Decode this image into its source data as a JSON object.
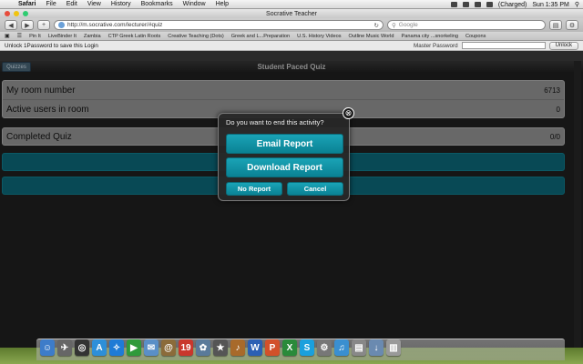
{
  "menubar": {
    "items": [
      "Safari",
      "File",
      "Edit",
      "View",
      "History",
      "Bookmarks",
      "Window",
      "Help"
    ],
    "battery": "(Charged)",
    "clock": "Sun 1:35 PM"
  },
  "window": {
    "title": "Socrative Teacher",
    "url": "http://m.socrative.com/lecturer/#quiz",
    "search_placeholder": "Google"
  },
  "bookmarks": [
    "Pin It",
    "LiveBinder It",
    "Zambia",
    "CTP Greek Latin Roots",
    "Creative Teaching (Dots)",
    "Greek and L...Preparation",
    "U.S. History Videos",
    "Outline Music World",
    "Panama city ...snorkeling",
    "Coupons"
  ],
  "password_bar": {
    "message": "Unlock 1Password to save this Login",
    "label": "Master Password",
    "unlock": "Unlock"
  },
  "page": {
    "quizzes_button": "Quizzes",
    "title": "Student Paced Quiz",
    "room_label": "My room number",
    "room_value": "6713",
    "active_label": "Active users in room",
    "active_value": "0",
    "completed_label": "Completed Quiz",
    "completed_value": "0/0"
  },
  "modal": {
    "title": "Do you want to end this activity?",
    "close_glyph": "⊗",
    "email": "Email Report",
    "download": "Download Report",
    "no_report": "No Report",
    "cancel": "Cancel"
  },
  "dock": {
    "icons": [
      {
        "name": "finder-icon",
        "glyph": "☺",
        "color": "#3d7cc9"
      },
      {
        "name": "launchpad-icon",
        "glyph": "✈",
        "color": "#666"
      },
      {
        "name": "dashboard-icon",
        "glyph": "◎",
        "color": "#333"
      },
      {
        "name": "app-store-icon",
        "glyph": "A",
        "color": "#2d8fd9"
      },
      {
        "name": "safari-icon",
        "glyph": "✧",
        "color": "#1f7bd6"
      },
      {
        "name": "facetime-icon",
        "glyph": "▶",
        "color": "#2f9a3a"
      },
      {
        "name": "mail-icon",
        "glyph": "✉",
        "color": "#5a8fc7"
      },
      {
        "name": "address-book-icon",
        "glyph": "@",
        "color": "#8b6b3a"
      },
      {
        "name": "calendar-icon",
        "glyph": "19",
        "color": "#c9372c"
      },
      {
        "name": "iphoto-icon",
        "glyph": "✿",
        "color": "#5a7a9a"
      },
      {
        "name": "imovie-icon",
        "glyph": "★",
        "color": "#555"
      },
      {
        "name": "garageband-icon",
        "glyph": "♪",
        "color": "#a86a2a"
      },
      {
        "name": "word-icon",
        "glyph": "W",
        "color": "#2b5fb4"
      },
      {
        "name": "powerpoint-icon",
        "glyph": "P",
        "color": "#d2502a"
      },
      {
        "name": "excel-icon",
        "glyph": "X",
        "color": "#2a8a3a"
      },
      {
        "name": "skype-icon",
        "glyph": "S",
        "color": "#1aa0dd"
      },
      {
        "name": "system-preferences-icon",
        "glyph": "⚙",
        "color": "#777"
      },
      {
        "name": "itunes-icon",
        "glyph": "♫",
        "color": "#3a8fd0"
      },
      {
        "name": "documents-icon",
        "glyph": "▤",
        "color": "#888"
      },
      {
        "name": "downloads-icon",
        "glyph": "↓",
        "color": "#6a8ab0"
      },
      {
        "name": "trash-icon",
        "glyph": "▥",
        "color": "#999"
      }
    ]
  }
}
